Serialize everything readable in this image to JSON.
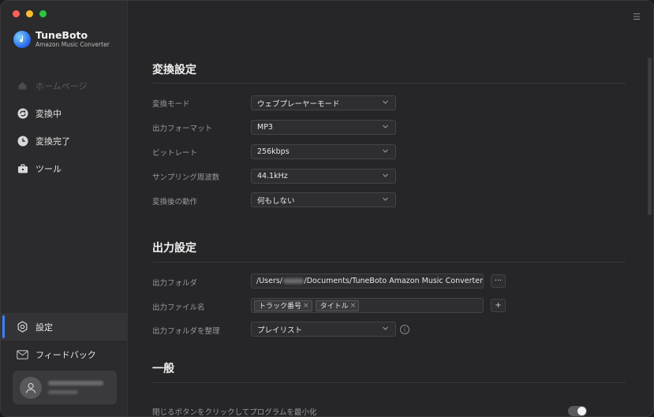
{
  "app": {
    "name": "TuneBoto",
    "subtitle": "Amazon Music Converter"
  },
  "sidebar": {
    "items": [
      {
        "label": "ホームページ",
        "icon": "home-icon",
        "disabled": true
      },
      {
        "label": "変換中",
        "icon": "converting-icon"
      },
      {
        "label": "変換完了",
        "icon": "clock-icon"
      },
      {
        "label": "ツール",
        "icon": "toolbox-icon"
      }
    ],
    "bottom": [
      {
        "label": "設定",
        "icon": "gear-icon",
        "active": true
      },
      {
        "label": "フィードバック",
        "icon": "mail-icon"
      }
    ]
  },
  "convert_settings": {
    "title": "変換設定",
    "rows": [
      {
        "label": "変換モード",
        "value": "ウェブプレーヤーモード"
      },
      {
        "label": "出力フォーマット",
        "value": "MP3"
      },
      {
        "label": "ビットレート",
        "value": "256kbps"
      },
      {
        "label": "サンプリング周波数",
        "value": "44.1kHz"
      },
      {
        "label": "変換後の動作",
        "value": "何もしない"
      }
    ]
  },
  "output_settings": {
    "title": "出力設定",
    "folder_label": "出力フォルダ",
    "folder_prefix": "/Users/",
    "folder_suffix": "/Documents/TuneBoto Amazon Music Converter",
    "browse_label": "···",
    "filename_label": "出力ファイル名",
    "filename_tags": [
      "トラック番号",
      "タイトル"
    ],
    "add_label": "+",
    "organize_label": "出力フォルダを整理",
    "organize_value": "プレイリスト",
    "info_label": "i"
  },
  "general": {
    "title": "一般",
    "minimize_label": "閉じるボタンをクリックしてプログラムを最小化"
  },
  "colors": {
    "accent": "#3b82f6",
    "background": "#262628",
    "sidebar": "#2b2b2d"
  }
}
